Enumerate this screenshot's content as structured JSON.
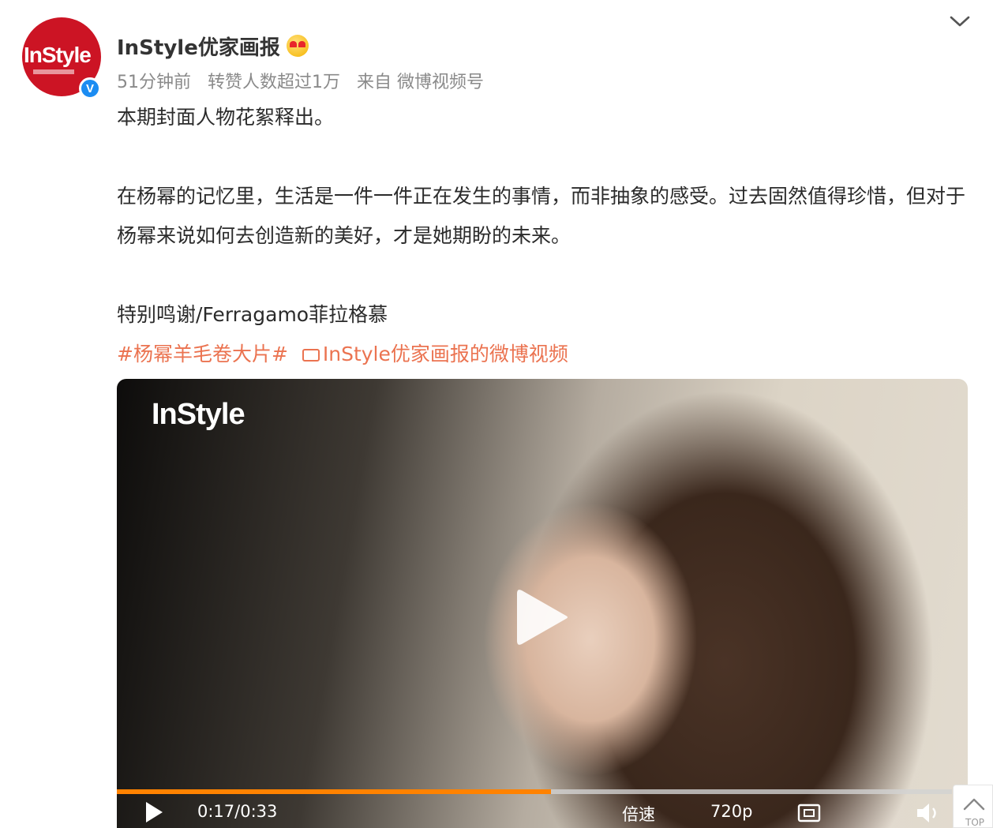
{
  "account": {
    "avatar_logo": "InStyle",
    "name": "InStyle优家画报",
    "verified_mark": "V",
    "name_emoji_icon": "heart-eyes-face-icon",
    "menu_icon": "chevron-down-icon"
  },
  "meta": {
    "time": "51分钟前",
    "reposts": "转赞人数超过1万",
    "source": "来自 微博视频号"
  },
  "post": {
    "line1": "本期封面人物花絮释出。",
    "paragraph2": "在杨幂的记忆里，生活是一件一件正在发生的事情，而非抽象的感受。过去固然值得珍惜，但对于杨幂来说如何去创造新的美好，才是她期盼的未来。",
    "thanks": "特别鸣谢/Ferragamo菲拉格慕",
    "topic_tag": "#杨幂羊毛卷大片#",
    "video_link": "InStyle优家画报的微博视频"
  },
  "video": {
    "watermark": "InStyle",
    "progress": 0.52,
    "time": "0:17/0:33",
    "speed_label": "倍速",
    "quality_label": "720p"
  },
  "colors": {
    "accent_link": "#eb7350",
    "progress": "#ff8200",
    "brand_red": "#cc1424",
    "verified_blue": "#1b8cf2"
  },
  "scroll_top": {
    "label": "TOP"
  }
}
